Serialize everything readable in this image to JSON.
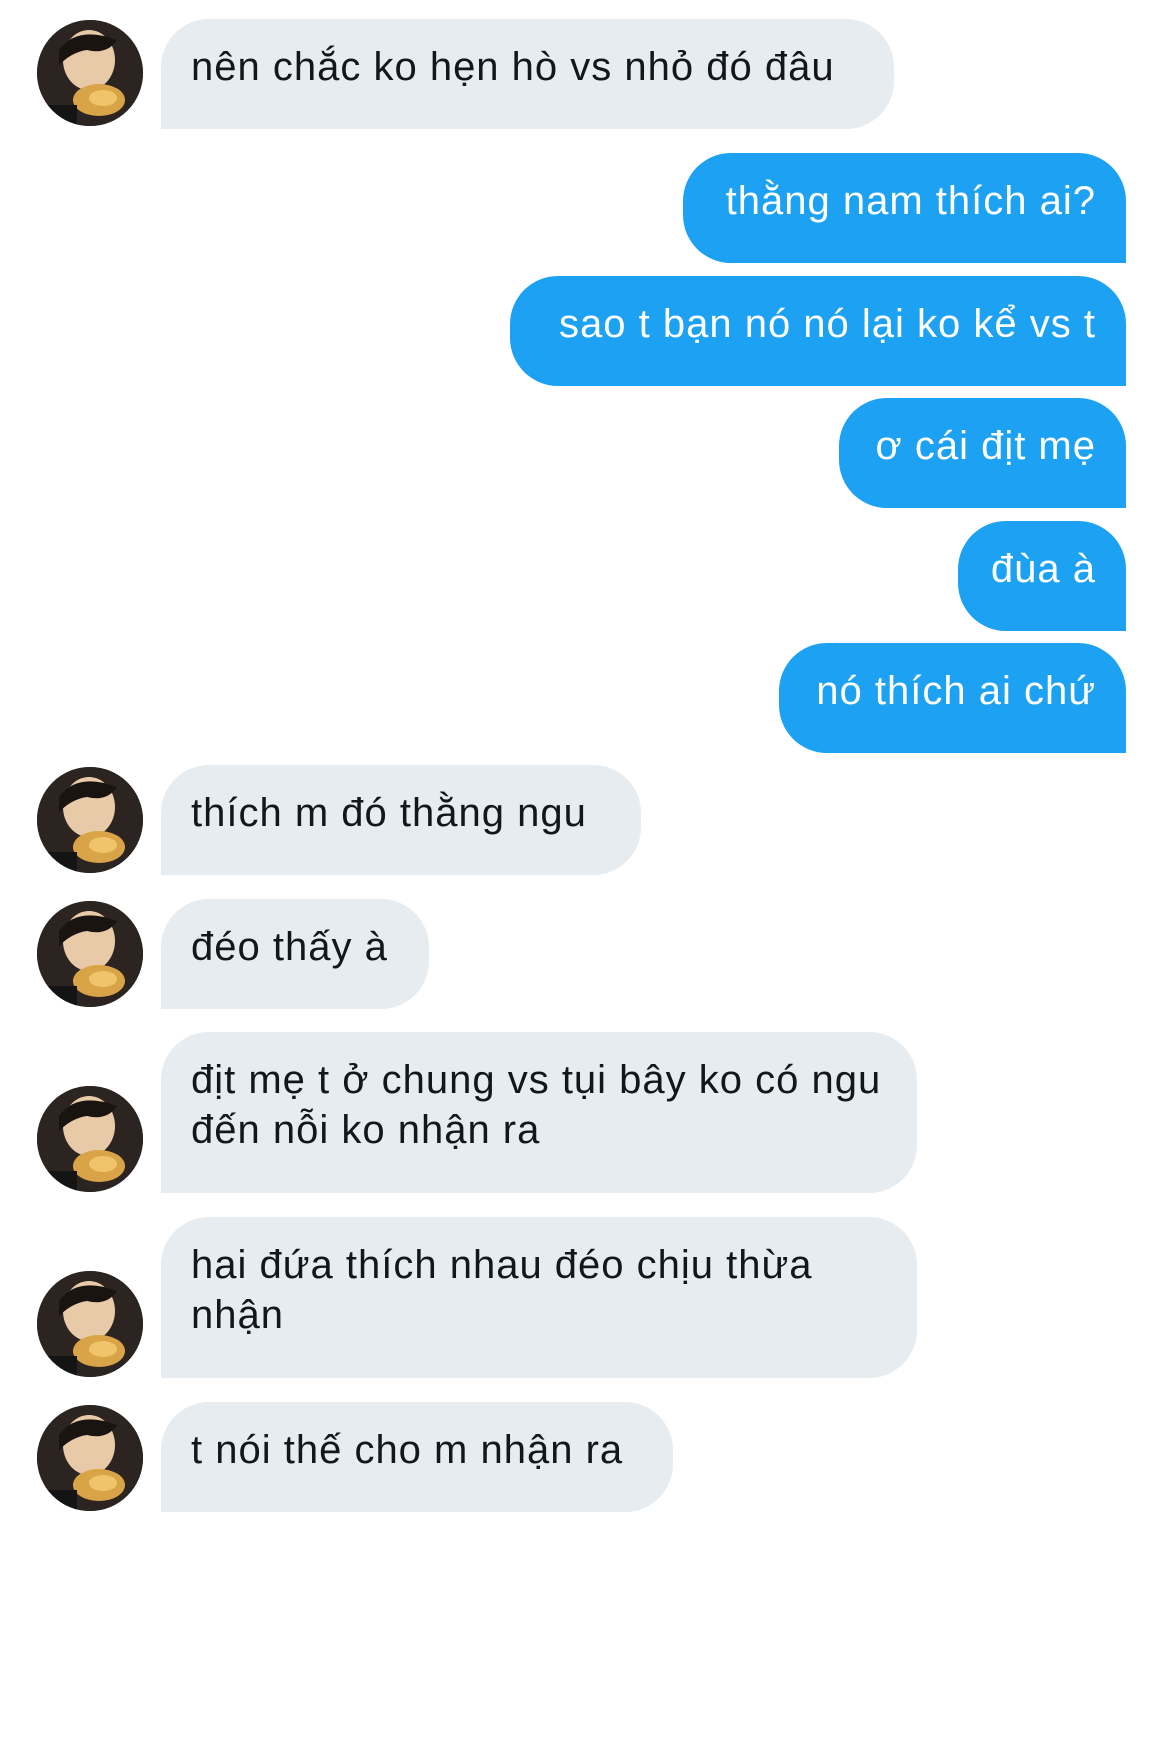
{
  "conversation": {
    "messages": [
      {
        "sender": "them",
        "text": "nên chắc ko hẹn hò vs nhỏ đó đâu"
      },
      {
        "sender": "me",
        "text": "thằng nam thích ai?"
      },
      {
        "sender": "me",
        "text": "sao t bạn nó nó lại ko kể vs t"
      },
      {
        "sender": "me",
        "text": "ơ cái địt mẹ"
      },
      {
        "sender": "me",
        "text": "đùa à"
      },
      {
        "sender": "me",
        "text": "nó thích ai chứ"
      },
      {
        "sender": "them",
        "text": "thích m đó thằng ngu"
      },
      {
        "sender": "them",
        "text": "đéo thấy à"
      },
      {
        "sender": "them",
        "text": "địt mẹ t ở chung vs tụi bây ko có ngu đến nỗi ko nhận ra"
      },
      {
        "sender": "them",
        "text": "hai đứa thích nhau đéo chịu thừa nhận"
      },
      {
        "sender": "them",
        "text": "t nói thế cho m nhận ra"
      }
    ]
  },
  "colors": {
    "incoming_bubble": "#e6ecf0",
    "outgoing_bubble": "#1da1f2",
    "incoming_text": "#14171a",
    "outgoing_text": "#ffffff"
  },
  "icons": {
    "avatar": "profile-photo-avatar"
  }
}
